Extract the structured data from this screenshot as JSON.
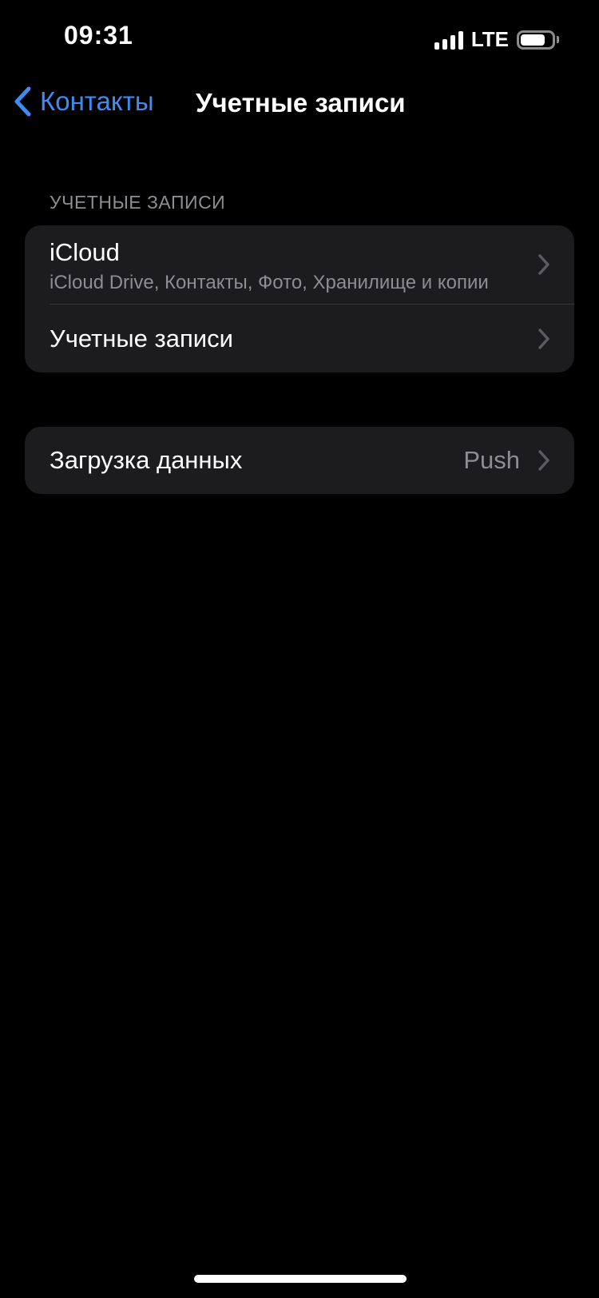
{
  "status_bar": {
    "time": "09:31",
    "network": "LTE",
    "signal_bars": 4,
    "battery_percent": 80,
    "icons": [
      "signal-icon",
      "battery-icon"
    ]
  },
  "nav": {
    "back_label": "Контакты",
    "title": "Учетные записи",
    "back_icon": "chevron-left-icon"
  },
  "section": {
    "header": "УЧЕТНЫЕ ЗАПИСИ",
    "rows": [
      {
        "title": "iCloud",
        "subtitle": "iCloud Drive, Контакты, Фото, Хранилище и копии"
      },
      {
        "title": "Учетные записи"
      }
    ]
  },
  "fetch": {
    "title": "Загрузка данных",
    "value": "Push"
  },
  "colors": {
    "background": "#000000",
    "group_background": "#1c1c1e",
    "accent": "#3e8cf2",
    "secondary_text": "#8d8d92"
  }
}
